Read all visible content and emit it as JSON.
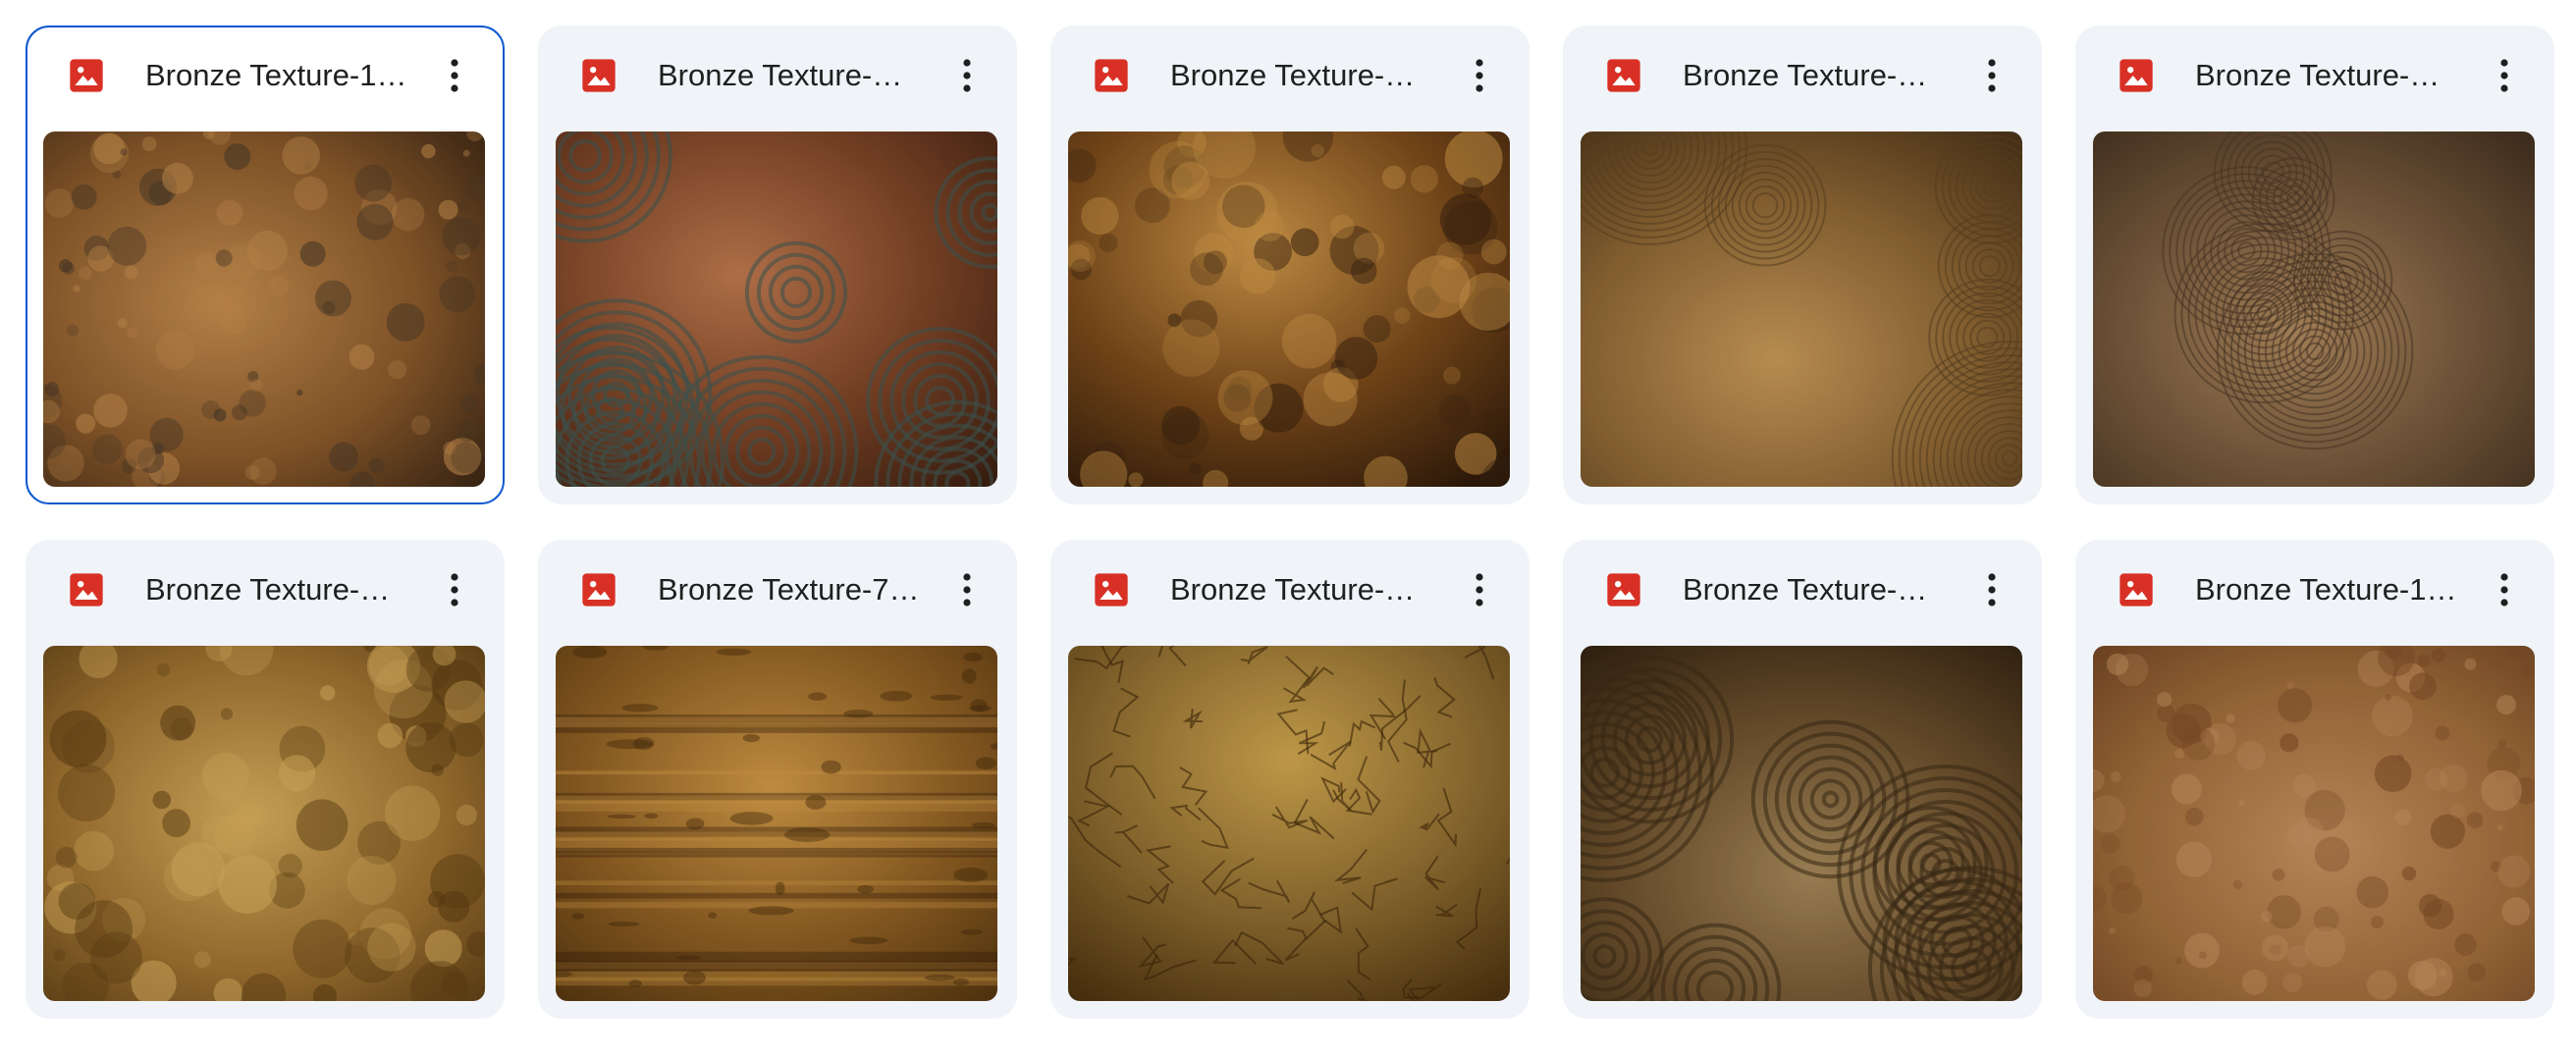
{
  "files": [
    {
      "name": "Bronze Texture-1…",
      "selected": true,
      "palette": [
        "#1f140c",
        "#8a5a2b",
        "#c89050",
        "#4a3a28"
      ],
      "pattern": "mottled"
    },
    {
      "name": "Bronze Texture-…",
      "selected": false,
      "palette": [
        "#2a150c",
        "#7a4226",
        "#c07a50",
        "#3d5a58"
      ],
      "pattern": "swirl"
    },
    {
      "name": "Bronze Texture-…",
      "selected": false,
      "palette": [
        "#1e1006",
        "#7a4a1a",
        "#d29a4a",
        "#3a2410"
      ],
      "pattern": "relief"
    },
    {
      "name": "Bronze Texture-…",
      "selected": false,
      "palette": [
        "#3a2612",
        "#8a6434",
        "#c89a5a",
        "#5a4020"
      ],
      "pattern": "rings"
    },
    {
      "name": "Bronze Texture-…",
      "selected": false,
      "palette": [
        "#2a1e12",
        "#6e5238",
        "#b08a60",
        "#4a3626"
      ],
      "pattern": "rings"
    },
    {
      "name": "Bronze Texture-…",
      "selected": false,
      "palette": [
        "#3a2408",
        "#9a7030",
        "#d8b060",
        "#5a3c12"
      ],
      "pattern": "relief"
    },
    {
      "name": "Bronze Texture-7…",
      "selected": false,
      "palette": [
        "#3a2408",
        "#8a5c22",
        "#d09a48",
        "#2a1808"
      ],
      "pattern": "stripes"
    },
    {
      "name": "Bronze Texture-…",
      "selected": false,
      "palette": [
        "#3a2408",
        "#8a6a30",
        "#d0a850",
        "#5a3a14"
      ],
      "pattern": "cracks"
    },
    {
      "name": "Bronze Texture-…",
      "selected": false,
      "palette": [
        "#22160a",
        "#6a4e2c",
        "#a88a5c",
        "#3a2a16"
      ],
      "pattern": "swirl"
    },
    {
      "name": "Bronze Texture-1…",
      "selected": false,
      "palette": [
        "#5a3418",
        "#9a6a3a",
        "#c29060",
        "#7a4a26"
      ],
      "pattern": "mottled"
    }
  ],
  "icons": {
    "file_type": "image-file-icon",
    "file_type_color": "#d93025",
    "more": "more-vert-icon"
  }
}
